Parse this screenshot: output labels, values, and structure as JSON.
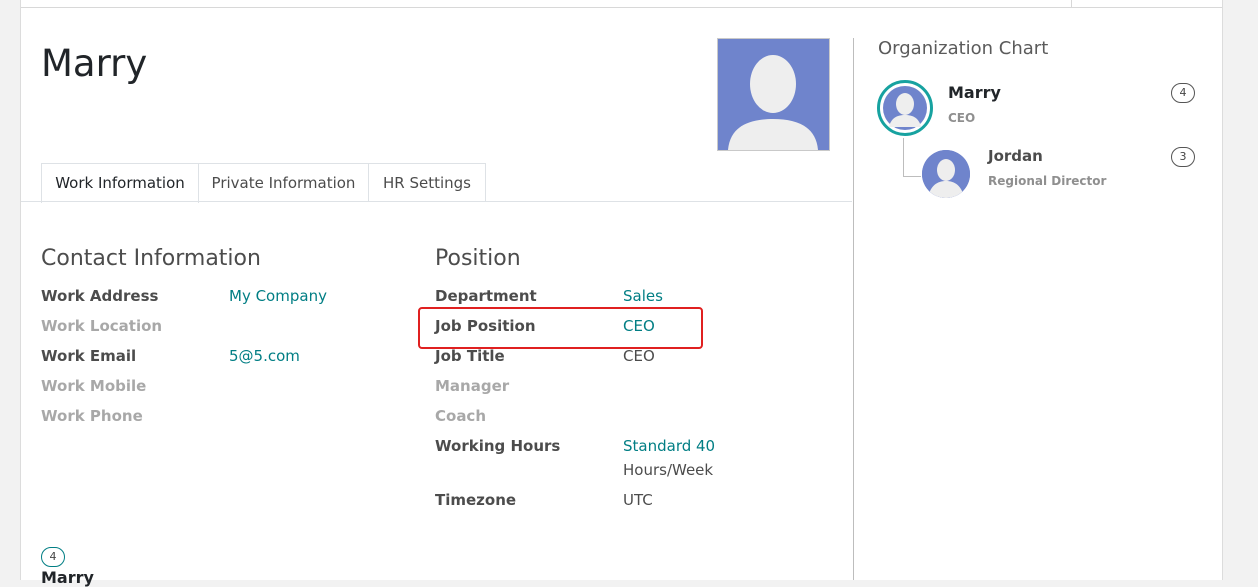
{
  "employee": {
    "name": "Marry"
  },
  "tabs": [
    {
      "label": "Work Information"
    },
    {
      "label": "Private Information"
    },
    {
      "label": "HR Settings"
    }
  ],
  "contact": {
    "title": "Contact Information",
    "fields": [
      {
        "label": "Work Address",
        "value": "My Company"
      },
      {
        "label": "Work Location",
        "value": ""
      },
      {
        "label": "Work Email",
        "value": "5@5.com"
      },
      {
        "label": "Work Mobile",
        "value": ""
      },
      {
        "label": "Work Phone",
        "value": ""
      }
    ]
  },
  "position": {
    "title": "Position",
    "fields": [
      {
        "label": "Department",
        "value": "Sales"
      },
      {
        "label": "Job Position",
        "value": "CEO"
      },
      {
        "label": "Job Title",
        "value": "CEO"
      },
      {
        "label": "Manager",
        "value": ""
      },
      {
        "label": "Coach",
        "value": ""
      },
      {
        "label": "Working Hours",
        "value_line1": "Standard 40",
        "value_line2": "Hours/Week"
      },
      {
        "label": "Timezone",
        "value": "UTC"
      }
    ]
  },
  "org_chart": {
    "title": "Organization Chart",
    "self": {
      "name": "Marry",
      "job": "CEO",
      "count": "4"
    },
    "subordinates": [
      {
        "name": "Jordan",
        "job": "Regional Director",
        "count": "3"
      }
    ]
  },
  "bottom": {
    "count": "4",
    "name": "Marry"
  },
  "colors": {
    "link": "#017e84",
    "highlight": "#e02020",
    "avatar_bg": "#6f84cc"
  }
}
